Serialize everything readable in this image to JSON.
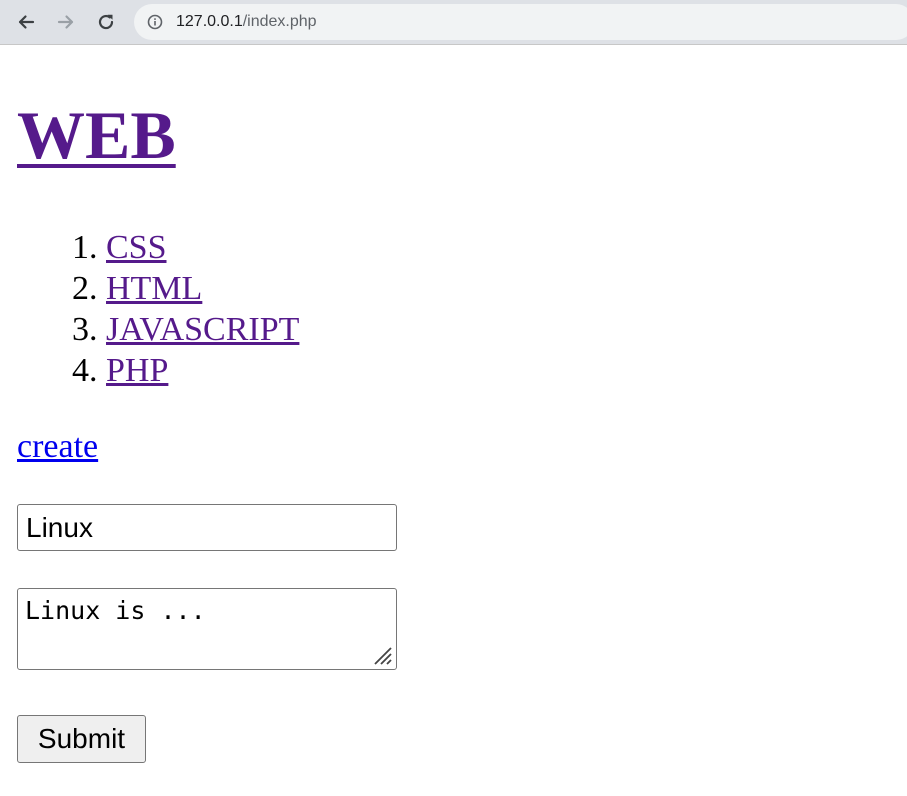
{
  "browser": {
    "url_host": "127.0.0.1",
    "url_path": "/index.php",
    "icons": {
      "back": "arrow-left-icon",
      "forward": "arrow-right-icon",
      "reload": "reload-icon",
      "site_info": "info-icon"
    }
  },
  "page": {
    "title": "WEB",
    "topics": [
      {
        "label": "CSS"
      },
      {
        "label": "HTML"
      },
      {
        "label": "JAVASCRIPT"
      },
      {
        "label": "PHP"
      }
    ],
    "create_link": "create",
    "form": {
      "title_value": "Linux",
      "description_value": "Linux is ...",
      "submit_label": "Submit"
    }
  },
  "colors": {
    "visited_link": "#551a8b",
    "unvisited_link": "#0000ee",
    "toolbar_bg": "#dee1e6",
    "omnibox_bg": "#f1f3f4"
  }
}
